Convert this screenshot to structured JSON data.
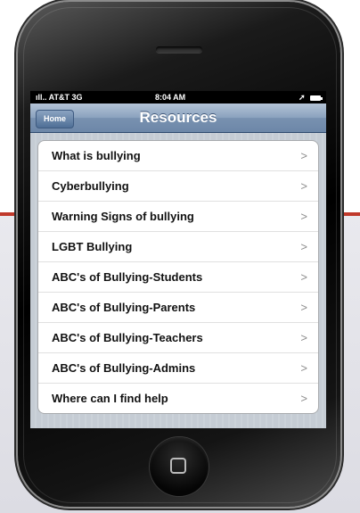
{
  "status_bar": {
    "carrier": "AT&T 3G",
    "time": "8:04 AM"
  },
  "nav": {
    "back_label": "Home",
    "title": "Resources"
  },
  "menu": {
    "items": [
      {
        "label": "What is bullying",
        "chevron": ">"
      },
      {
        "label": "Cyberbullying",
        "chevron": ">"
      },
      {
        "label": "Warning Signs of bullying",
        "chevron": ">"
      },
      {
        "label": "LGBT Bullying",
        "chevron": ">"
      },
      {
        "label": "ABC's of Bullying-Students",
        "chevron": ">"
      },
      {
        "label": "ABC's of Bullying-Parents",
        "chevron": ">"
      },
      {
        "label": "ABC's of Bullying-Teachers",
        "chevron": ">"
      },
      {
        "label": "ABC's of Bullying-Admins",
        "chevron": ">"
      },
      {
        "label": "Where can I find help",
        "chevron": ">"
      }
    ]
  },
  "icons": {
    "signal": "signal-bars-icon",
    "location": "location-arrow-icon",
    "battery": "battery-icon",
    "home_button": "home-square-icon"
  },
  "colors": {
    "nav_bar": "#7891b0",
    "table_background": "#c5ccd4",
    "accent_line": "#c0392b"
  }
}
